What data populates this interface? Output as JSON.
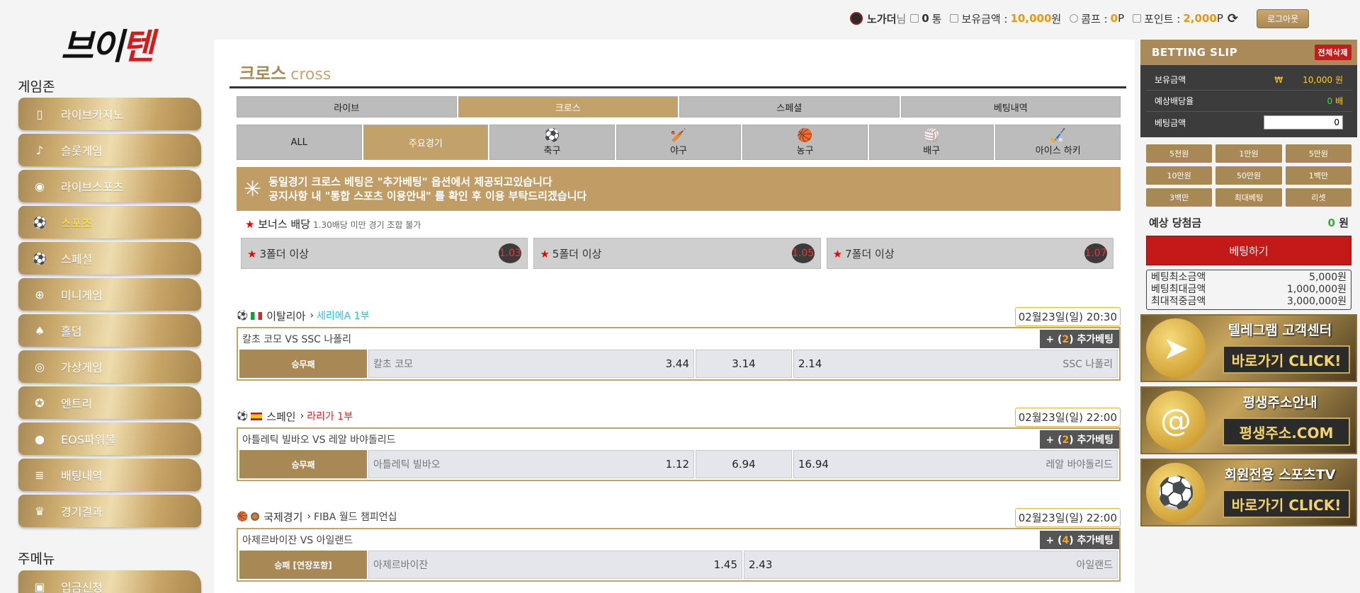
{
  "logo": {
    "part1": "브이",
    "part2": "텐"
  },
  "sidebar": {
    "game_zone_title": "게임존",
    "items": [
      {
        "label": "라이브카지노",
        "icon": "phone-icon"
      },
      {
        "label": "슬롯게임",
        "icon": "slot-icon"
      },
      {
        "label": "라이브스포츠",
        "icon": "live-icon"
      },
      {
        "label": "스포츠",
        "icon": "soccer-icon"
      },
      {
        "label": "스페셜",
        "icon": "soccer-icon"
      },
      {
        "label": "미니게임",
        "icon": "gamepad-icon"
      },
      {
        "label": "홀덤",
        "icon": "cards-icon"
      },
      {
        "label": "가상게임",
        "icon": "vr-icon"
      },
      {
        "label": "엔트리",
        "icon": "entry-icon"
      },
      {
        "label": "EOS파워볼",
        "icon": "ball-icon"
      },
      {
        "label": "배팅내역",
        "icon": "list-icon"
      },
      {
        "label": "경기결과",
        "icon": "trophy-icon"
      }
    ],
    "main_menu_title": "주메뉴",
    "main_items": [
      {
        "label": "입금신청",
        "icon": "deposit-icon"
      }
    ]
  },
  "topbar": {
    "username": "노가더",
    "suffix": "님",
    "messages": "0",
    "messages_unit": "통",
    "balance_label": "보유금액 :",
    "balance": "10,000",
    "balance_unit": "원",
    "comp_label": "콤프 :",
    "comp": "0",
    "comp_unit": "P",
    "points_label": "포인트 :",
    "points": "2,000",
    "points_unit": "P",
    "logout": "로그아웃"
  },
  "main": {
    "title_ko": "크로스",
    "title_en": "cross",
    "tabs": [
      {
        "label": "라이브",
        "active": false
      },
      {
        "label": "크로스",
        "active": true
      },
      {
        "label": "스페셜",
        "active": false
      },
      {
        "label": "베팅내역",
        "active": false
      }
    ],
    "sports": [
      {
        "label": "ALL",
        "icon": ""
      },
      {
        "label": "주요경기",
        "icon": ""
      },
      {
        "label": "축구",
        "icon": "⚽"
      },
      {
        "label": "야구",
        "icon": "🏏"
      },
      {
        "label": "농구",
        "icon": "🏀"
      },
      {
        "label": "배구",
        "icon": "🏐"
      },
      {
        "label": "아이스 하키",
        "icon": "🏑"
      }
    ],
    "notice": {
      "line1": "동일경기 크로스 베팅은 \"추가베팅\" 옵션에서 제공되고있습니다",
      "line2": "공지사항 내 \"통합 스포츠 이용안내\" 를 확인 후 이용 부탁드리겠습니다"
    },
    "bonus": {
      "title": "보너스 배당",
      "sub": "1.30배당 미만 경기 조합 불가",
      "items": [
        {
          "label": "3폴더 이상",
          "odds": "1.03"
        },
        {
          "label": "5폴더 이상",
          "odds": "1.05"
        },
        {
          "label": "7폴더 이상",
          "odds": "1.07"
        }
      ]
    },
    "matches": [
      {
        "country": "이탈리아",
        "league_arrow": "›",
        "league": "세리에A 1부",
        "league_color": "#2cc1e0",
        "time": "02월23일(일) 20:30",
        "title": "칼초 코모 VS SSC 나폴리",
        "extra_prefix": "+ (",
        "extra_num": "2",
        "extra_suffix": ") 추가베팅",
        "type": "승무패",
        "home": "칼초 코모",
        "home_odds": "3.44",
        "draw_odds": "3.14",
        "away": "SSC 나폴리",
        "away_odds": "2.14"
      },
      {
        "country": "스페인",
        "league_arrow": "›",
        "league": "라리가 1부",
        "league_color": "#e0262c",
        "time": "02월23일(일) 22:00",
        "title": "아틀레틱 빌바오 VS 레알 바야돌리드",
        "extra_prefix": "+ (",
        "extra_num": "2",
        "extra_suffix": ") 추가베팅",
        "type": "승무패",
        "home": "아틀레틱 빌바오",
        "home_odds": "1.12",
        "draw_odds": "6.94",
        "away": "레알 바야돌리드",
        "away_odds": "16.94"
      },
      {
        "country": "국제경기",
        "league_arrow": "›",
        "league": "FIBA 월드 챔피언십",
        "league_color": "#444444",
        "time": "02월23일(일) 22:00",
        "title": "아제르바이잔 VS 아일랜드",
        "extra_prefix": "+ (",
        "extra_num": "4",
        "extra_suffix": ") 추가베팅",
        "type": "승패 [연장포함]",
        "home": "아제르바이잔",
        "home_odds": "1.45",
        "away": "아일랜드",
        "away_odds": "2.43"
      }
    ]
  },
  "slip": {
    "title": "BETTING SLIP",
    "clear": "전체삭제",
    "balance_label": "보유금액",
    "balance_currency": "₩",
    "balance": "10,000 원",
    "odds_label": "예상배당율",
    "odds_value": "0",
    "odds_unit": "배",
    "bet_label": "베팅금액",
    "bet_value": "0",
    "chips": [
      "5천원",
      "1만원",
      "5만원",
      "10만원",
      "50만원",
      "1백만",
      "3백만",
      "최대베팅",
      "리셋"
    ],
    "expected_label": "예상 당첨금",
    "expected_value": "0",
    "expected_unit": "원",
    "bet_button": "베팅하기",
    "limits": [
      {
        "label": "베팅최소금액",
        "value": "5,000원"
      },
      {
        "label": "베팅최대금액",
        "value": "1,000,000원"
      },
      {
        "label": "최대적중금액",
        "value": "3,000,000원"
      }
    ],
    "banners": [
      {
        "title": "텔레그램 고객센터",
        "button": "바로가기 CLICK!",
        "icon": "➤"
      },
      {
        "title": "평생주소안내",
        "button": "평생주소.COM",
        "icon": "@"
      },
      {
        "title": "회원전용 스포츠TV",
        "button": "바로가기 CLICK!",
        "icon": "⚽"
      }
    ]
  },
  "colors": {
    "gold": "#a98a58",
    "red": "#c41919",
    "highlight": "#e39a12"
  }
}
